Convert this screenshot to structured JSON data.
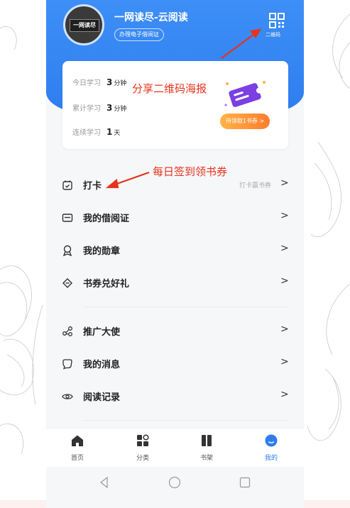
{
  "profile": {
    "name": "一网读尽-云阅读",
    "card_badge": "办理电子借阅证",
    "avatar_text": "一网读尽"
  },
  "qr": {
    "label": "二维码"
  },
  "stats": {
    "today": {
      "label": "今日学习",
      "value": "3",
      "unit": "分钟"
    },
    "total": {
      "label": "累计学习",
      "value": "3",
      "unit": "分钟"
    },
    "streak": {
      "label": "连续学习",
      "value": "1",
      "unit": "天"
    },
    "claim_button": "待领取1书券 >"
  },
  "menu": {
    "items": [
      {
        "label": "打卡",
        "hint": "打卡赢书券",
        "arrow": ">"
      },
      {
        "label": "我的借阅证",
        "arrow": ">"
      },
      {
        "label": "我的勋章",
        "arrow": ">"
      },
      {
        "label": "书券兑好礼",
        "arrow": ">"
      },
      {
        "label": "推广大使",
        "arrow": ">"
      },
      {
        "label": "我的消息",
        "arrow": ">"
      },
      {
        "label": "阅读记录",
        "arrow": ">"
      }
    ]
  },
  "tabbar": {
    "tabs": [
      {
        "label": "首页",
        "icon": "home-icon"
      },
      {
        "label": "分类",
        "icon": "category-icon"
      },
      {
        "label": "书架",
        "icon": "bookshelf-icon"
      },
      {
        "label": "我的",
        "icon": "profile-icon",
        "active": true
      }
    ]
  },
  "annotations": {
    "qr_poster": "分享二维码海报",
    "checkin": "每日签到领书券"
  },
  "colors": {
    "primary": "#2f7df0",
    "annotation": "#e8321a",
    "claim": "#ff7d2e"
  }
}
